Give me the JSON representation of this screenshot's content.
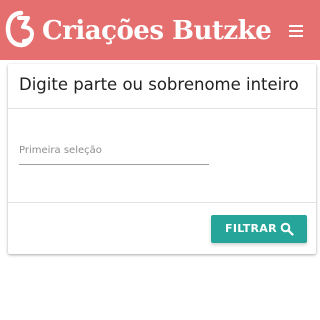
{
  "header": {
    "brand": "Criações Butzke",
    "background_color": "#e56f6f",
    "logo_icon": "cb-monogram-icon",
    "menu_icon": "hamburger-menu-icon"
  },
  "card": {
    "title": "Digite parte ou sobrenome inteiro",
    "field": {
      "label": "Primeira seleção",
      "value": ""
    },
    "filter_button": {
      "label": "FILTRAR",
      "icon": "search-icon",
      "color": "#26a69a"
    }
  }
}
